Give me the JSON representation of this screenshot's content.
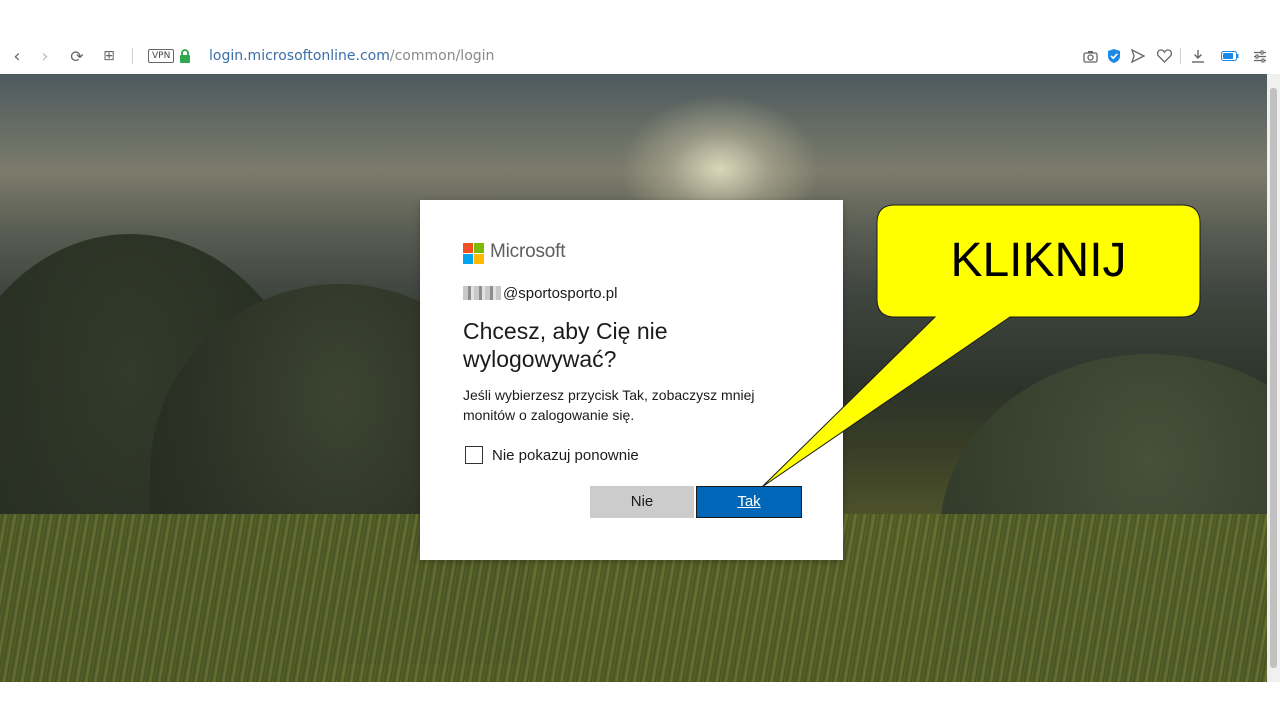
{
  "browser": {
    "url_host": "login.microsoftonline.com",
    "url_path": "/common/login",
    "vpn_label": "VPN",
    "icons": [
      "back-icon",
      "forward-icon",
      "reload-icon",
      "grid-icon",
      "vpn-icon",
      "lock-icon",
      "camera-icon",
      "shield-icon",
      "send-icon",
      "heart-icon",
      "download-icon",
      "battery-icon",
      "settings-icon"
    ]
  },
  "dialog": {
    "brand": "Microsoft",
    "account_suffix": "@sportosporto.pl",
    "title": "Chcesz, aby Cię nie wylogowywać?",
    "description": "Jeśli wybierzesz przycisk Tak, zobaczysz mniej monitów o zalogowanie się.",
    "checkbox_label": "Nie pokazuj ponownie",
    "checkbox_checked": false,
    "button_no": "Nie",
    "button_yes": "Tak"
  },
  "callout": {
    "text": "KLIKNIJ",
    "color": "#ffff00"
  },
  "colors": {
    "accent": "#0067b8",
    "ms_red": "#f25022",
    "ms_green": "#7fba00",
    "ms_blue": "#00a4ef",
    "ms_yellow": "#ffb900"
  }
}
